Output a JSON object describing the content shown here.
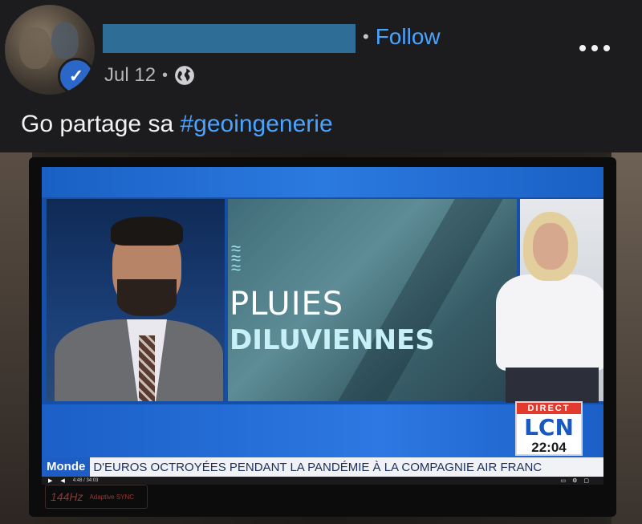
{
  "post": {
    "author_name_redacted": true,
    "follow_label": "Follow",
    "date": "Jul 12",
    "privacy_icon": "globe-icon",
    "more_icon": "more-horizontal-icon",
    "caption_text": "Go partage sa ",
    "caption_hashtag": "#geoingenerie"
  },
  "tv": {
    "weather_title_line1": "PLUIES",
    "weather_title_line2": "DILUVIENNES",
    "live_badge": "DIRECT",
    "channel_logo": "LCN",
    "time": "22:04",
    "ticker_label": "Monde",
    "ticker_text": "D'EUROS OCTROYÉES PENDANT LA PANDÉMIE À LA COMPAGNIE AIR FRANC",
    "player_time": "4:48 / 34:03"
  },
  "monitor": {
    "refresh_rate": "144Hz",
    "sync_label": "Adaptive SYNC"
  },
  "colors": {
    "background": "#1c1c1e",
    "link": "#4aa3ff",
    "redaction": "#2e6d95",
    "tv_blue": "#1b5fc7"
  }
}
